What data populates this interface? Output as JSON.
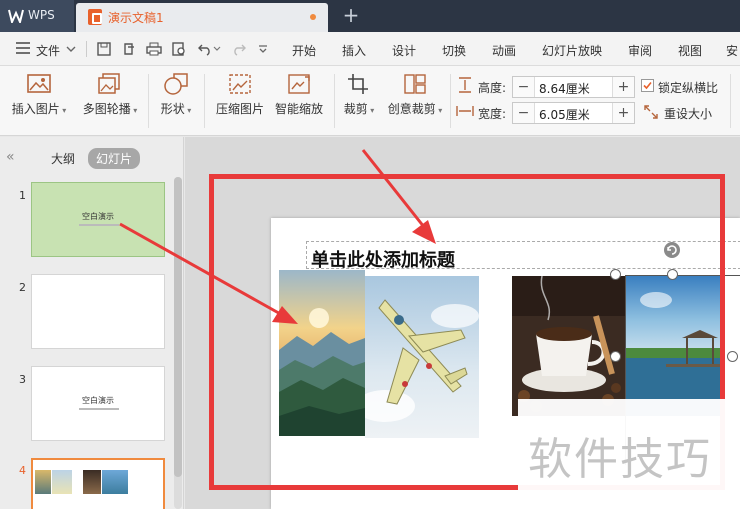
{
  "titlebar": {
    "app_name": "WPS",
    "doc_tab_title": "演示文稿1",
    "new_tab_symbol": "+"
  },
  "menubar": {
    "file_label": "文件",
    "items": [
      "开始",
      "插入",
      "设计",
      "切换",
      "动画",
      "幻灯片放映",
      "审阅",
      "视图",
      "安"
    ]
  },
  "ribbon": {
    "insert_picture": "插入图片",
    "multi_carousel": "多图轮播",
    "shape": "形状",
    "compress_picture": "压缩图片",
    "smart_scale": "智能缩放",
    "crop": "裁剪",
    "creative_crop": "创意裁剪",
    "height_label": "高度:",
    "height_value": "8.64厘米",
    "width_label": "宽度:",
    "width_value": "6.05厘米",
    "lock_ratio": "锁定纵横比",
    "reset_size": "重设大小",
    "minus": "−",
    "plus": "+"
  },
  "leftpanel": {
    "collapse_symbol": "«",
    "tab_outline": "大纲",
    "tab_slides": "幻灯片",
    "slides": [
      {
        "num": "1",
        "title": "空白演示"
      },
      {
        "num": "2",
        "title": ""
      },
      {
        "num": "3",
        "title": "空白演示"
      },
      {
        "num": "4",
        "title": ""
      }
    ]
  },
  "slide": {
    "title_placeholder": "单击此处添加标题"
  },
  "watermark": "软件技巧",
  "colors": {
    "accent_orange": "#e8612c",
    "annotation_red": "#e83a3a",
    "titlebar_bg": "#2c3544",
    "active_slide_bg": "#c8e2b2"
  }
}
